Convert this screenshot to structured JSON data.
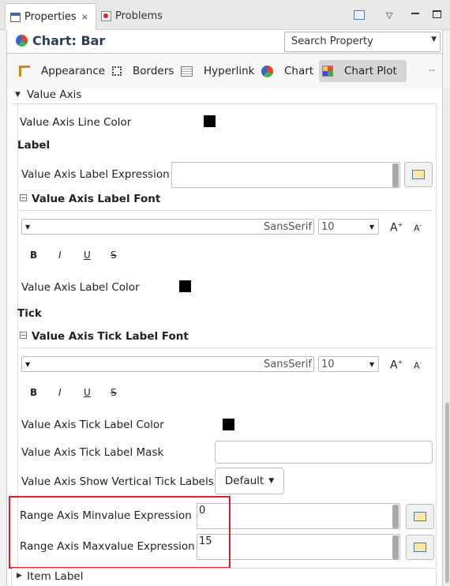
{
  "tabs": {
    "properties_label": "Properties",
    "problems_label": "Problems"
  },
  "header": {
    "title": "Chart: Bar",
    "search_placeholder": "Search Property"
  },
  "toolbar": {
    "items": [
      "Appearance",
      "Borders",
      "Hyperlink",
      "Chart",
      "Chart Plot"
    ],
    "selected": "Chart Plot",
    "more": "--"
  },
  "sections": {
    "value_axis_label": "Value Axis",
    "value_axis_line_color": "Value Axis Line Color",
    "label_heading": "Label",
    "value_axis_label_expression": "Value Axis Label Expression",
    "value_axis_label_font": "Value Axis Label Font",
    "font_name": "SansSerif",
    "font_size": "10",
    "value_axis_label_color": "Value Axis Label Color",
    "tick_heading": "Tick",
    "value_axis_tick_label_font": "Value Axis Tick Label Font",
    "tick_font_name": "SansSerif",
    "tick_font_size": "10",
    "value_axis_tick_label_color": "Value Axis Tick Label Color",
    "value_axis_tick_label_mask": "Value Axis Tick Label Mask",
    "value_axis_show_vertical": "Value Axis Show Vertical Tick Labels",
    "default_option": "Default",
    "range_min_label": "Range Axis Minvalue Expression",
    "range_min_value": "0",
    "range_max_label": "Range Axis Maxvalue Expression",
    "range_max_value": "15",
    "item_label": "Item Label"
  },
  "formatting": {
    "bold": "B",
    "italic": "I",
    "underline": "U",
    "strike": "S",
    "grow": "A",
    "shrink": "A"
  },
  "colors": {
    "swatch": "#000000",
    "highlight": "#d81f26"
  }
}
